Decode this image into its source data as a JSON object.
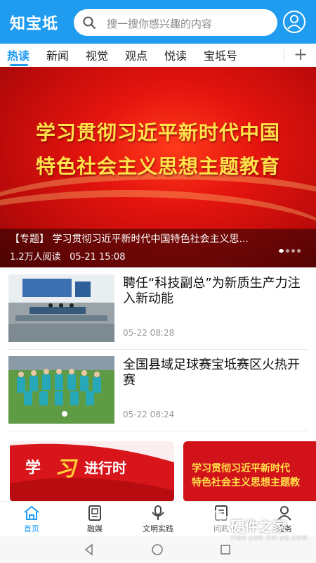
{
  "header": {
    "logo": "知宝坻",
    "search_placeholder": "搜一搜你感兴趣的内容",
    "user_icon": "user-circle-icon",
    "colors": {
      "brand": "#1f9bf0"
    }
  },
  "tabs": [
    {
      "label": "热读",
      "active": true
    },
    {
      "label": "新闻"
    },
    {
      "label": "视觉"
    },
    {
      "label": "观点"
    },
    {
      "label": "悦读"
    },
    {
      "label": "宝坻号"
    }
  ],
  "tab_add": "+",
  "banner": {
    "line1": "学习贯彻习近平新时代中国",
    "line2": "特色社会主义思想主题教育",
    "caption": "【专题】 学习贯彻习近平新时代中国特色社会主义思...",
    "reads": "1.2万人阅读",
    "time": "05-21 15:08"
  },
  "news": [
    {
      "title": "聘任“科技副总”为新质生产力注入新动能",
      "time": "05-22 08:28"
    },
    {
      "title": "全国县域足球赛宝坻赛区火热开赛",
      "time": "05-22 08:24"
    }
  ],
  "cards": [
    {
      "text_left": "学",
      "text_mid": "习",
      "text_right": "进行时"
    },
    {
      "line1": "学习贯彻习近平新时代",
      "line2": "特色社会主义思想主题教"
    }
  ],
  "bottom_nav": [
    {
      "label": "首页",
      "icon": "home-icon",
      "active": true
    },
    {
      "label": "融媒",
      "icon": "media-icon"
    },
    {
      "label": "文明实践",
      "icon": "microphone-icon"
    },
    {
      "label": "问政",
      "icon": "inquiry-icon"
    },
    {
      "label": "服务",
      "icon": "service-icon"
    }
  ],
  "watermark": {
    "text": "硬件之家",
    "sub": "YING JIAN ZHI JIA.COM"
  }
}
